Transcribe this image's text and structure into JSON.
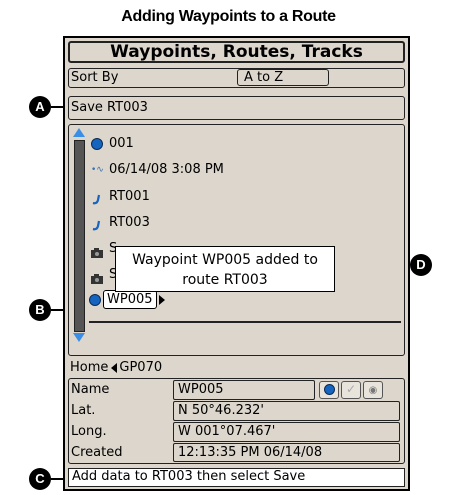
{
  "caption": "Adding Waypoints to a Route",
  "header": {
    "title": "Waypoints, Routes, Tracks"
  },
  "sort": {
    "label": "Sort By",
    "value": "A to Z"
  },
  "save": {
    "label": "Save RT003"
  },
  "list": {
    "items": [
      {
        "icon": "waypoint-icon",
        "label": "001"
      },
      {
        "icon": "track-icon",
        "label": "06/14/08 3:08 PM"
      },
      {
        "icon": "route-icon",
        "label": "RT001"
      },
      {
        "icon": "route-icon",
        "label": "RT003"
      },
      {
        "icon": "camera-icon",
        "label": "S"
      },
      {
        "icon": "camera-icon",
        "label": "S"
      }
    ],
    "selected": {
      "icon": "waypoint-icon",
      "label": "WP005"
    }
  },
  "popup": {
    "line1": "Waypoint WP005 added to",
    "line2": "route RT003"
  },
  "nav": {
    "home": "Home",
    "location": "GP070"
  },
  "details": {
    "name_label": "Name",
    "name_value": "WP005",
    "lat_label": "Lat.",
    "lat_value": "N 50°46.232'",
    "long_label": "Long.",
    "long_value": "W 001°07.467'",
    "created_label": "Created",
    "created_value": "12:13:35 PM 06/14/08"
  },
  "hint": "Add data to RT003 then select Save",
  "callouts": {
    "a": "A",
    "b": "B",
    "c": "C",
    "d": "D"
  },
  "colors": {
    "panel": "#dcd6cc",
    "waypoint_blue": "#1565c0",
    "scroll_blue": "#3a8ee6"
  }
}
